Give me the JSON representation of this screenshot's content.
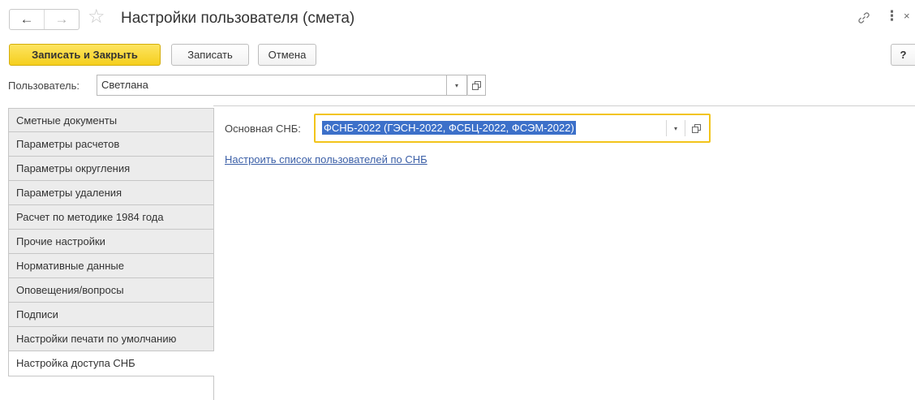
{
  "window": {
    "title": "Настройки пользователя (смета)",
    "nav_back_icon": "←",
    "nav_forward_icon": "→",
    "star_icon": "☆",
    "more_icon": "⋮",
    "close_icon": "×"
  },
  "toolbar": {
    "save_close_label": "Записать и Закрыть",
    "save_label": "Записать",
    "cancel_label": "Отмена",
    "help_label": "?"
  },
  "user": {
    "label": "Пользователь:",
    "value": "Светлана",
    "dropdown_icon": "▾"
  },
  "tabs": [
    {
      "label": "Сметные документы",
      "active": false
    },
    {
      "label": "Параметры расчетов",
      "active": false
    },
    {
      "label": "Параметры округления",
      "active": false
    },
    {
      "label": "Параметры удаления",
      "active": false
    },
    {
      "label": "Расчет по методике 1984 года",
      "active": false
    },
    {
      "label": "Прочие настройки",
      "active": false
    },
    {
      "label": "Нормативные данные",
      "active": false
    },
    {
      "label": "Оповещения/вопросы",
      "active": false
    },
    {
      "label": "Подписи",
      "active": false
    },
    {
      "label": "Настройки печати по умолчанию",
      "active": false
    },
    {
      "label": "Настройка доступа СНБ",
      "active": true
    }
  ],
  "main": {
    "snb_label": "Основная СНБ:",
    "snb_value": "ФСНБ-2022 (ГЭСН-2022, ФСБЦ-2022, ФСЭМ-2022)",
    "snb_dropdown_icon": "▾",
    "configure_link": "Настроить список пользователей по СНБ"
  },
  "colors": {
    "primary_button": "#f5cf1d",
    "focus_border": "#f2c41a",
    "selection": "#3c70c9",
    "link": "#3b5fa7"
  }
}
